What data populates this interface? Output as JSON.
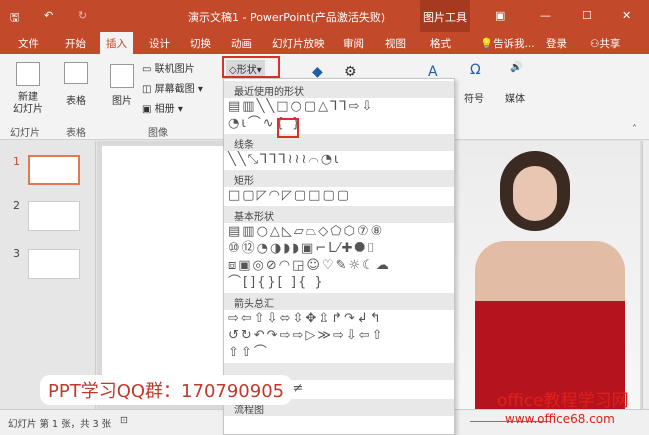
{
  "titlebar": {
    "title": "演示文稿1 - PowerPoint(产品激活失败)",
    "context_tab": "图片工具",
    "save": "🖫",
    "undo": "↶",
    "redo": "↻"
  },
  "tabs": [
    "文件",
    "开始",
    "插入",
    "设计",
    "切换",
    "动画",
    "幻灯片放映",
    "审阅",
    "视图",
    "格式"
  ],
  "tell_me": "告诉我...",
  "login": "登录",
  "share": "共享",
  "ribbon": {
    "new_slide": "新建\n幻灯片",
    "table": "表格",
    "picture": "图片",
    "online_picture": "联机图片",
    "screenshot": "屏幕截图",
    "album": "相册",
    "shapes": "形状",
    "symbol": "符号",
    "media": "媒体",
    "groups": [
      "幻灯片",
      "表格",
      "图像"
    ]
  },
  "shapes_menu": {
    "sections": [
      {
        "title": "最近使用的形状",
        "rows": [
          "▤▥╲╲□○▢△⅂⅂⇨⇩",
          "◔ɩ⌒∿{ }"
        ]
      },
      {
        "title": "线条",
        "rows": [
          "╲╲⤡⅂⅂⅂≀≀≀⌒◔ɩ"
        ]
      },
      {
        "title": "矩形",
        "rows": [
          "□▢◸◠◸▢□▢▢"
        ]
      },
      {
        "title": "基本形状",
        "rows": [
          "▤▥○△◺▱⏢◇⬠⬡⑦⑧",
          "⑩⑫◔◑◗◗▣⌐L⁄✚⯃⌷",
          "⧈▣◎⊘◠◲☺♡✎☼☾☁",
          "⌒[]{}[ ]{ }"
        ]
      },
      {
        "title": "箭头总汇",
        "rows": [
          "⇨⇦⇧⇩⬄⇳✥⇫↱↷↲↰",
          "↺↻↶↷⇨⇨▷≫⇨⇩⇦⇧",
          "⇧⇧⌒"
        ]
      },
      {
        "title": "",
        "rows": [
          "⊕−×÷≡≠"
        ]
      },
      {
        "title": "流程图",
        "rows": []
      }
    ]
  },
  "slides": [
    "1",
    "2",
    "3"
  ],
  "status": {
    "slide_info": "幻灯片 第 1 张，共 3 张"
  },
  "watermarks": {
    "qq": "PPT学习QQ群：170790905",
    "site": "office教程学习网",
    "url": "www.office68.com"
  }
}
